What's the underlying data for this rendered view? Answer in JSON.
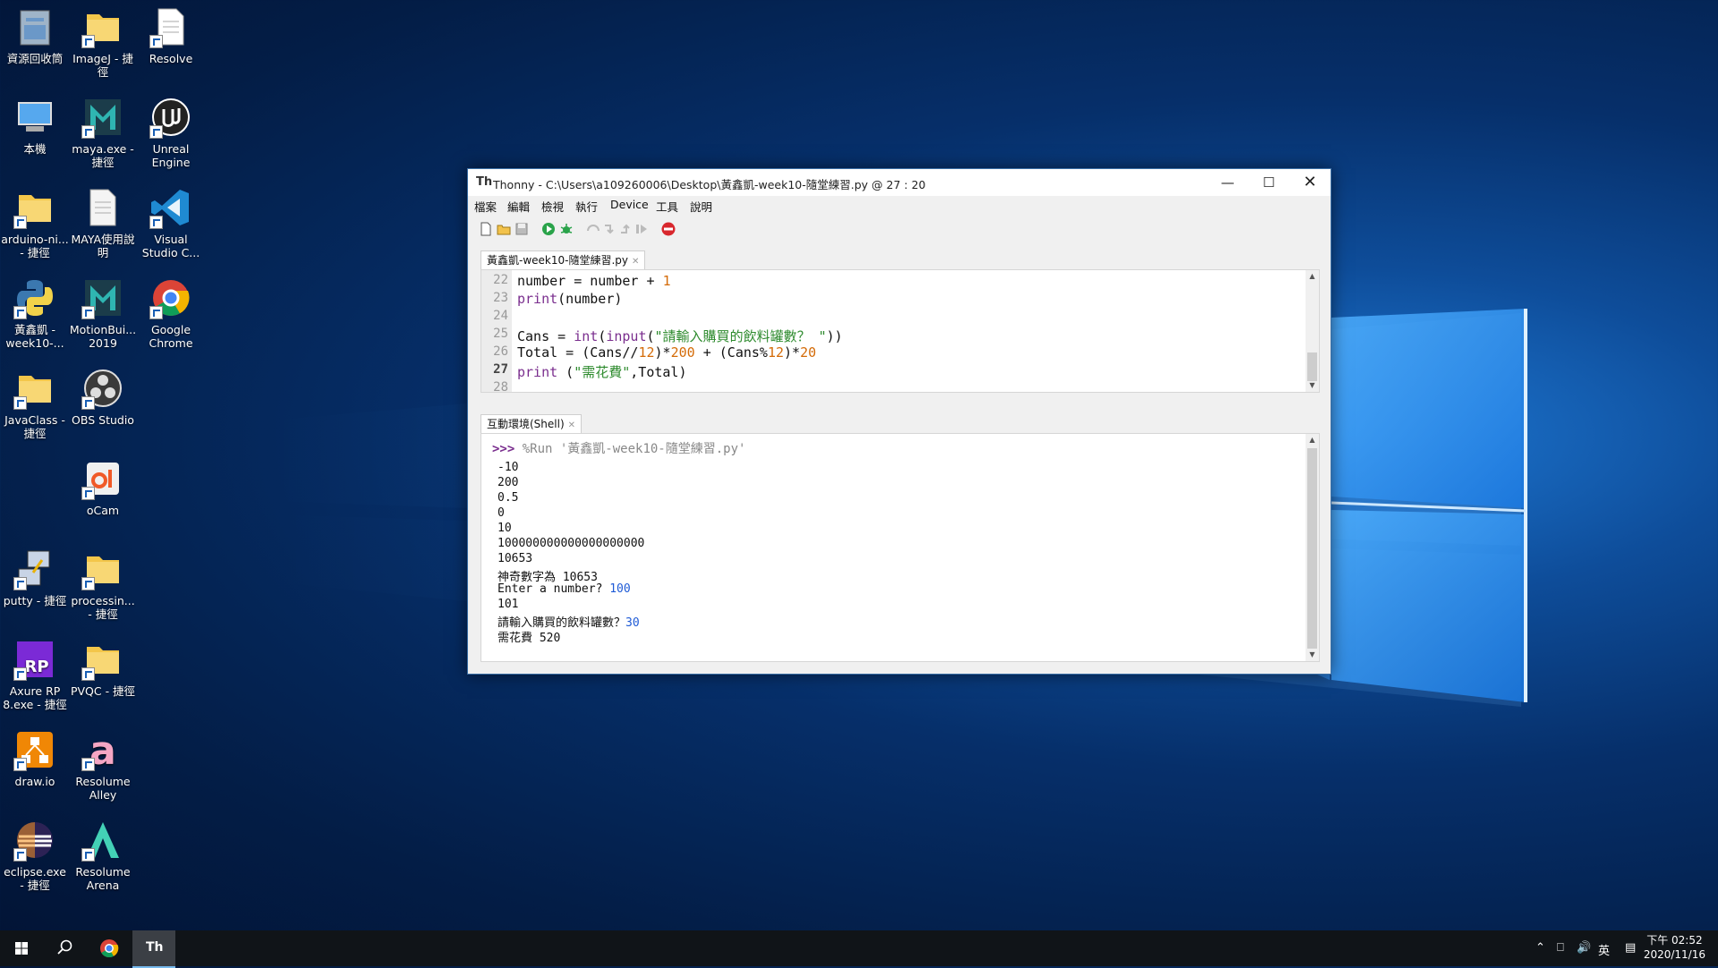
{
  "desktop": {
    "icons": [
      {
        "label": "資源回收筒",
        "icon": "recycle-bin-icon"
      },
      {
        "label": "ImageJ - 捷徑",
        "icon": "folder-icon"
      },
      {
        "label": "Resolve",
        "icon": "file-icon"
      },
      {
        "label": "本機",
        "icon": "computer-icon"
      },
      {
        "label": "maya.exe - 捷徑",
        "icon": "maya-icon"
      },
      {
        "label": "Unreal Engine",
        "icon": "unreal-icon"
      },
      {
        "label": "arduino-ni... - 捷徑",
        "icon": "folder-icon"
      },
      {
        "label": "MAYA使用說明",
        "icon": "document-icon"
      },
      {
        "label": "Visual Studio C...",
        "icon": "vscode-icon"
      },
      {
        "label": "黃鑫凱 -week10-...",
        "icon": "python-icon"
      },
      {
        "label": "MotionBui... 2019",
        "icon": "motionbuilder-icon"
      },
      {
        "label": "Google Chrome",
        "icon": "chrome-icon"
      },
      {
        "label": "JavaClass - 捷徑",
        "icon": "folder-icon"
      },
      {
        "label": "OBS Studio",
        "icon": "obs-icon"
      },
      {
        "label": "oCam",
        "icon": "ocam-icon"
      },
      {
        "label": "putty - 捷徑",
        "icon": "putty-icon"
      },
      {
        "label": "processin... - 捷徑",
        "icon": "folder-icon"
      },
      {
        "label": "Axure RP 8.exe - 捷徑",
        "icon": "axure-icon"
      },
      {
        "label": "PVQC - 捷徑",
        "icon": "folder-icon"
      },
      {
        "label": "draw.io",
        "icon": "drawio-icon"
      },
      {
        "label": "Resolume Alley",
        "icon": "resolume-alley-icon"
      },
      {
        "label": "eclipse.exe - 捷徑",
        "icon": "eclipse-icon"
      },
      {
        "label": "Resolume Arena",
        "icon": "resolume-arena-icon"
      }
    ]
  },
  "window": {
    "app": "Thonny",
    "title": "Thonny  -  C:\\Users\\a109260006\\Desktop\\黃鑫凱-week10-隨堂練習.py  @  27 : 20",
    "menu": [
      "檔案",
      "編輯",
      "檢視",
      "執行",
      "Device",
      "工具",
      "說明"
    ],
    "toolbar": [
      "new-file-icon",
      "open-file-icon",
      "save-icon",
      "run-icon",
      "debug-icon",
      "step-over-icon",
      "step-into-icon",
      "step-out-icon",
      "resume-icon",
      "stop-icon"
    ],
    "editor_tab": "黃鑫凱-week10-隨堂練習.py",
    "line_numbers": [
      "22",
      "23",
      "24",
      "25",
      "26",
      "27",
      "28"
    ],
    "current_line": "27",
    "shell_tab": "互動環境(Shell)",
    "shell": {
      "prompt": ">>>",
      "command": "%Run '黃鑫凱-week10-隨堂練習.py'",
      "output": [
        "-10",
        "200",
        "0.5",
        "0",
        "10",
        "100000000000000000000",
        "10653",
        "神奇數字為 10653"
      ],
      "prompt1": "Enter a number? ",
      "input1": "100",
      "after1": "101",
      "prompt2": "請輸入購買的飲料罐數？",
      "input2": "30",
      "final": "需花費 520"
    }
  },
  "taskbar": {
    "ime": "英",
    "time": "下午 02:52",
    "date": "2020/11/16"
  }
}
